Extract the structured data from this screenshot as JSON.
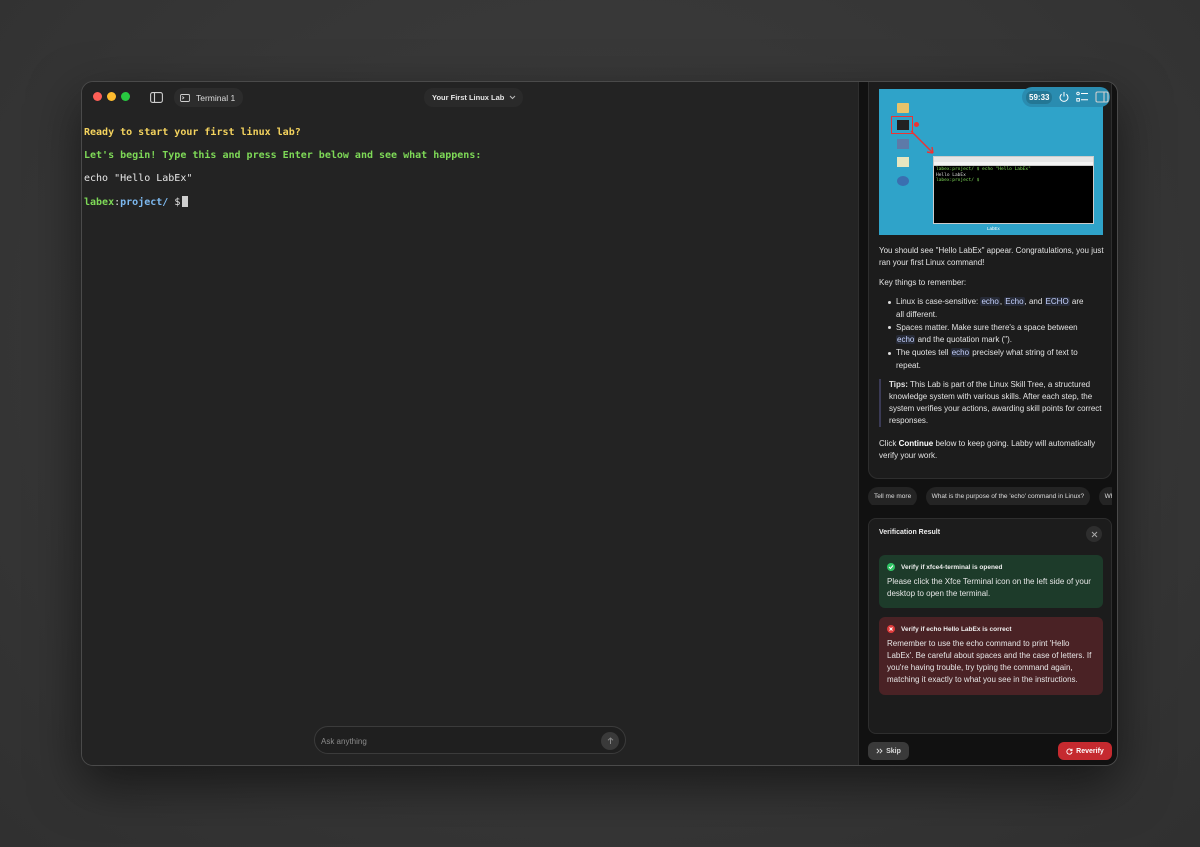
{
  "window": {
    "terminal_tab": "Terminal 1",
    "lab_title": "Your First Linux Lab"
  },
  "terminal": {
    "line1": "Ready to start your first linux lab?",
    "line2": "Let's begin! Type this and press Enter below and see what happens:",
    "line3": "echo \"Hello LabEx\"",
    "prompt_host": "labex",
    "prompt_sep": ":",
    "prompt_path": "project/",
    "prompt_symbol": " $"
  },
  "ask": {
    "placeholder": "Ask anything"
  },
  "panel": {
    "timer": "59:33",
    "screenshot": {
      "desktop_label": "LabEx",
      "mini_lines": [
        "labex:project/ $ echo \"Hello LabEx\"",
        "Hello LabEx",
        "labex:project/ $"
      ]
    },
    "p1": "You should see \"Hello LabEx\" appear. Congratulations, you just ran your first Linux command!",
    "key_heading": "Key things to remember:",
    "bullet1_pre": "Linux is case-sensitive: ",
    "bullet1_c1": "echo",
    "bullet1_sep1": ", ",
    "bullet1_c2": "Echo",
    "bullet1_sep2": ", and ",
    "bullet1_c3": "ECHO",
    "bullet1_post": " are all different.",
    "bullet2_pre": "Spaces matter. Make sure there's a space between ",
    "bullet2_c1": "echo",
    "bullet2_post": " and the quotation mark (\").",
    "bullet3_pre": "The quotes tell ",
    "bullet3_c1": "echo",
    "bullet3_post": " precisely what string of text to repeat.",
    "tips_label": "Tips:",
    "tips_text": " This Lab is part of the Linux Skill Tree, a structured knowledge system with various skills. After each step, the system verifies your actions, awarding skill points for correct responses.",
    "click_pre": "Click ",
    "click_bold": "Continue",
    "click_post": " below to keep going. Labby will automatically verify your work."
  },
  "chips": [
    "Tell me more",
    "What is the purpose of the 'echo' command in Linux?",
    "Wh"
  ],
  "verification": {
    "title": "Verification Result",
    "ok_title": "Verify if xfce4-terminal is opened",
    "ok_body": "Please click the Xfce Terminal icon on the left side of your desktop to open the terminal.",
    "bad_title": "Verify if echo Hello LabEx is correct",
    "bad_body": "Remember to use the echo command to print 'Hello LabEx'. Be careful about spaces and the case of letters. If you're having trouble, try typing the command again, matching it exactly to what you see in the instructions."
  },
  "buttons": {
    "skip": "Skip",
    "reverify": "Reverify"
  },
  "colors": {
    "accent_red": "#c52a2f",
    "success_green": "#2fc464",
    "terminal_yellow": "#f4d35e",
    "terminal_green": "#7ed957"
  }
}
